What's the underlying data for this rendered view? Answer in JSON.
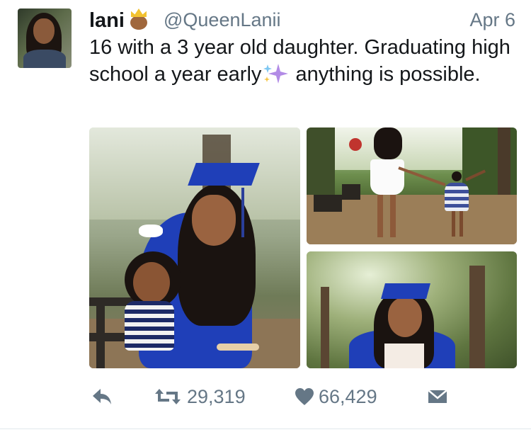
{
  "tweet": {
    "display_name": "lani",
    "name_emoji": "princess-emoji",
    "handle": "@QueenLanii",
    "date": "Apr 6",
    "text_before": "16 with a 3 year old daughter. Graduating high school a year early",
    "text_emoji": "sparkles-emoji",
    "text_after": " anything is possible."
  },
  "media": [
    {
      "alt": "graduate in blue cap and gown sitting on bench with daughter"
    },
    {
      "alt": "mother and daughter walking on path"
    },
    {
      "alt": "graduate in blue cap and gown among trees"
    }
  ],
  "actions": {
    "reply_icon": "reply-icon",
    "retweet_icon": "retweet-icon",
    "retweet_count": "29,319",
    "like_icon": "heart-icon",
    "like_count": "66,429",
    "dm_icon": "envelope-icon"
  },
  "colors": {
    "text": "#14171a",
    "secondary": "#657786",
    "gown_blue": "#1f3fb8",
    "divider": "#e1e8ed"
  }
}
